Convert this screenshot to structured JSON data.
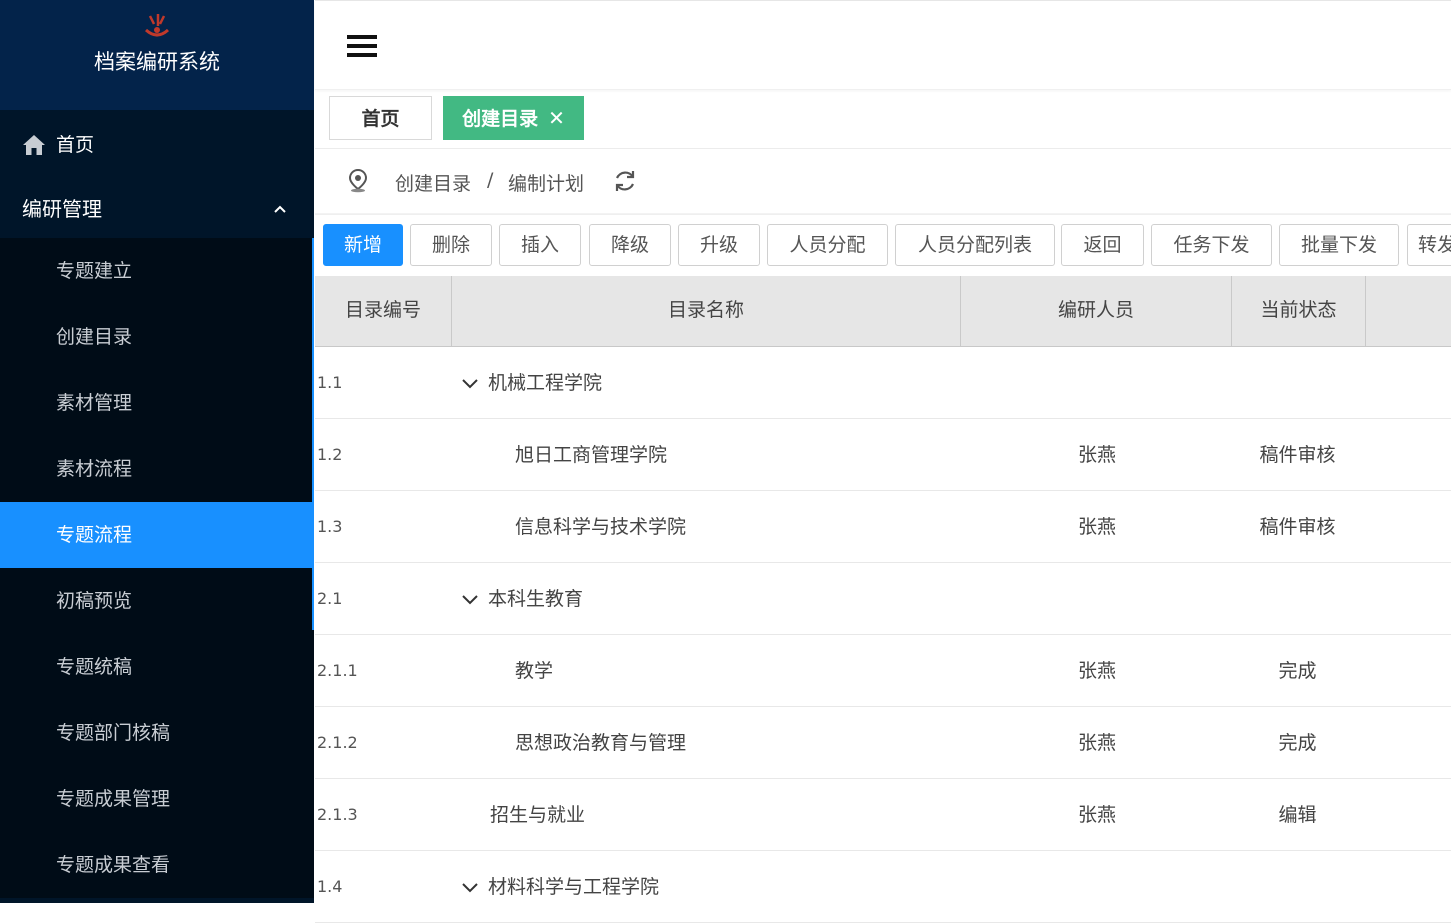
{
  "app": {
    "title": "档案编研系统"
  },
  "sidebar": {
    "home_label": "首页",
    "group_label": "编研管理",
    "items": [
      {
        "label": "专题建立"
      },
      {
        "label": "创建目录"
      },
      {
        "label": "素材管理"
      },
      {
        "label": "素材流程"
      },
      {
        "label": "专题流程",
        "active": true
      },
      {
        "label": "初稿预览"
      },
      {
        "label": "专题统稿"
      },
      {
        "label": "专题部门核稿"
      },
      {
        "label": "专题成果管理"
      },
      {
        "label": "专题成果查看"
      }
    ]
  },
  "tabs": {
    "home": "首页",
    "current": "创建目录",
    "close": "✕"
  },
  "breadcrumb": {
    "first": "创建目录",
    "sep": "/",
    "second": "编制计划"
  },
  "toolbar": {
    "buttons": [
      "新增",
      "删除",
      "插入",
      "降级",
      "升级",
      "人员分配",
      "人员分配列表",
      "返回",
      "任务下发",
      "批量下发",
      "转发"
    ]
  },
  "table": {
    "headers": [
      "目录编号",
      "目录名称",
      "编研人员",
      "当前状态"
    ],
    "rows": [
      {
        "code": "1.1",
        "name": "机械工程学院",
        "person": "",
        "status": "",
        "expandable": true,
        "level": 1
      },
      {
        "code": "1.2",
        "name": "旭日工商管理学院",
        "person": "张燕",
        "status": "稿件审核",
        "expandable": false,
        "level": 2
      },
      {
        "code": "1.3",
        "name": "信息科学与技术学院",
        "person": "张燕",
        "status": "稿件审核",
        "expandable": false,
        "level": 2
      },
      {
        "code": "2.1",
        "name": "本科生教育",
        "person": "",
        "status": "",
        "expandable": true,
        "level": 1
      },
      {
        "code": "2.1.1",
        "name": "教学",
        "person": "张燕",
        "status": "完成",
        "expandable": false,
        "level": 2
      },
      {
        "code": "2.1.2",
        "name": "思想政治教育与管理",
        "person": "张燕",
        "status": "完成",
        "expandable": false,
        "level": 2
      },
      {
        "code": "2.1.3",
        "name": "招生与就业",
        "person": "张燕",
        "status": "编辑",
        "expandable": false,
        "level": 1
      },
      {
        "code": "1.4",
        "name": "材料科学与工程学院",
        "person": "",
        "status": "",
        "expandable": true,
        "level": 1
      }
    ]
  },
  "colors": {
    "sidebar_bg": "#001529",
    "active": "#1890ff",
    "tab_active": "#42b983"
  }
}
